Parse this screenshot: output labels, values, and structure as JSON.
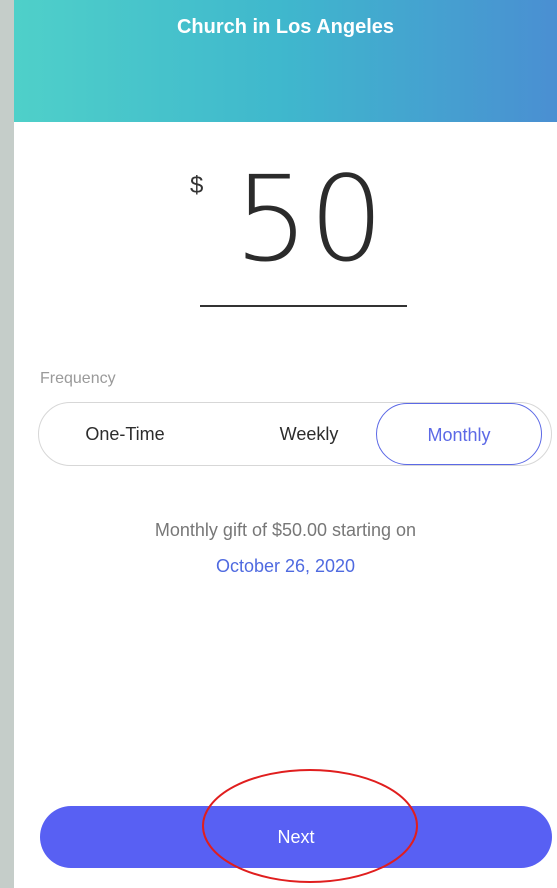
{
  "header": {
    "title": "Church in Los Angeles"
  },
  "amount": {
    "currency_symbol": "$",
    "value": "50"
  },
  "frequency": {
    "label": "Frequency",
    "options": [
      "One-Time",
      "Weekly",
      "Monthly"
    ],
    "selected": "Monthly"
  },
  "summary": {
    "text": "Monthly gift of $50.00 starting on",
    "date": "October 26, 2020"
  },
  "actions": {
    "next_label": "Next"
  },
  "colors": {
    "accent": "#5c69e6",
    "button": "#5860f3",
    "header_start": "#4fd0c9",
    "header_end": "#4a8fd2",
    "annotation": "#e01e1e"
  }
}
